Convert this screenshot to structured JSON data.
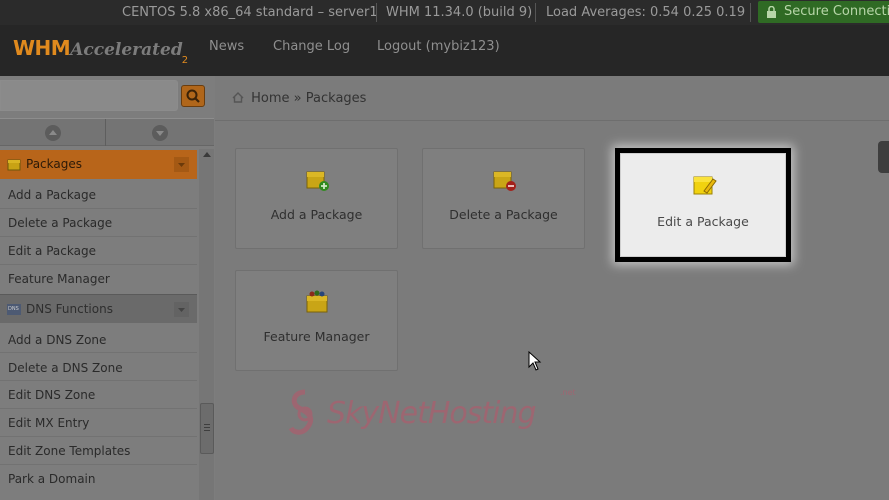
{
  "status_bar": {
    "os": "CENTOS 5.8 x86_64 standard – server1",
    "whm_version": "WHM 11.34.0 (build 9)",
    "load": "Load Averages: 0.54 0.25 0.19",
    "secure": "Secure Connection"
  },
  "header": {
    "logo_whm": "WHM",
    "logo_accelerated": "Accelerated",
    "logo_sub": "2",
    "nav": [
      {
        "label": "News"
      },
      {
        "label": "Change Log"
      },
      {
        "label": "Logout (mybiz123)"
      }
    ]
  },
  "sidebar": {
    "search": {
      "value": "",
      "placeholder": ""
    },
    "sections": [
      {
        "title": "Packages",
        "icon": "package-icon",
        "items": [
          "Add a Package",
          "Delete a Package",
          "Edit a Package",
          "Feature Manager"
        ]
      },
      {
        "title": "DNS Functions",
        "icon": "dns-icon",
        "items": [
          "Add a DNS Zone",
          "Delete a DNS Zone",
          "Edit DNS Zone",
          "Edit MX Entry",
          "Edit Zone Templates",
          "Park a Domain"
        ]
      }
    ]
  },
  "breadcrumb": {
    "home": "Home",
    "separator": "»",
    "current": "Packages"
  },
  "cards": [
    {
      "label": "Add a Package",
      "icon": "package-add-icon"
    },
    {
      "label": "Delete a Package",
      "icon": "package-delete-icon"
    },
    {
      "label": "Edit a Package",
      "icon": "package-edit-icon"
    },
    {
      "label": "Feature Manager",
      "icon": "feature-manager-icon"
    }
  ],
  "watermark": {
    "text": "SkyNetHosting",
    "sub": ".net"
  },
  "colors": {
    "accent": "#e08a1e",
    "secure": "#2f6a24",
    "section_active": "#b8651a"
  }
}
